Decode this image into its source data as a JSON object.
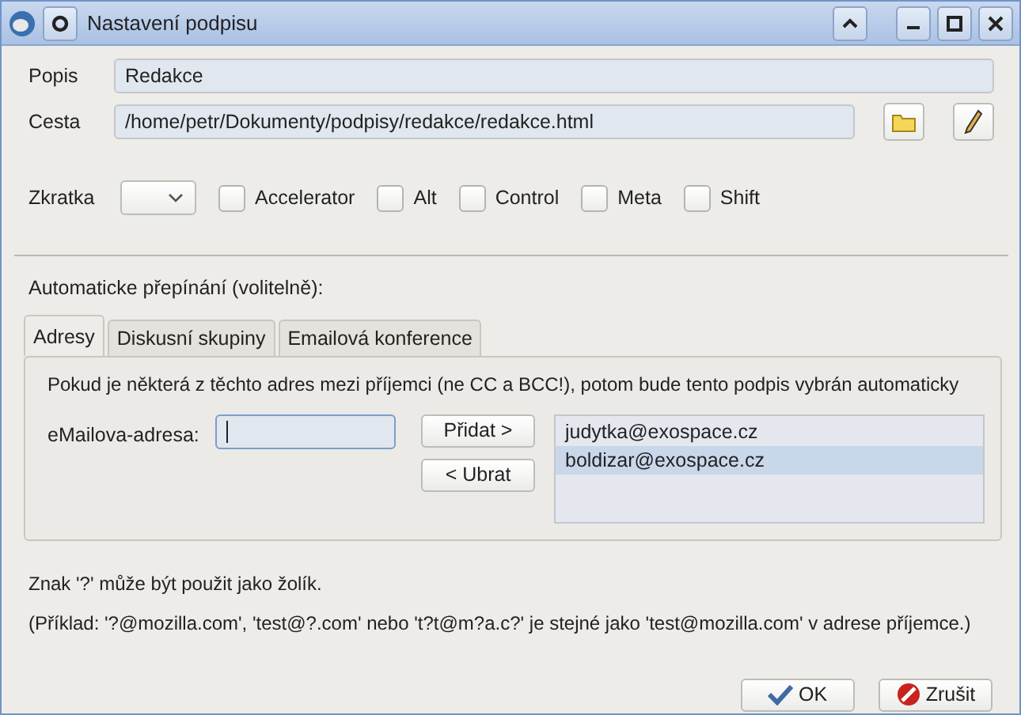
{
  "window": {
    "title": "Nastavení podpisu"
  },
  "fields": [
    {
      "label": "Popis",
      "value": "Redakce",
      "kind": "text"
    },
    {
      "label": "Cesta",
      "value": "/home/petr/Dokumenty/podpisy/redakce/redakce.html",
      "kind": "file"
    }
  ],
  "shortcut": {
    "label": "Zkratka",
    "modifiers": [
      {
        "label": "Accelerator",
        "checked": false
      },
      {
        "label": "Alt",
        "checked": false
      },
      {
        "label": "Control",
        "checked": false
      },
      {
        "label": "Meta",
        "checked": false
      },
      {
        "label": "Shift",
        "checked": false
      }
    ]
  },
  "auto_switch": {
    "label": "Automaticke přepínání (volitelně):",
    "tabs": [
      {
        "label": "Adresy",
        "selected": true
      },
      {
        "label": "Diskusní skupiny",
        "selected": false
      },
      {
        "label": "Emailová konference",
        "selected": false
      }
    ],
    "description": "Pokud je některá z těchto adres mezi příjemci (ne CC a BCC!), potom bude tento podpis vybrán automaticky",
    "address_label": "eMailova-adresa:",
    "add_button": "Přidat >",
    "remove_button": "< Ubrat",
    "addresses": [
      {
        "text": "judytka@exospace.cz",
        "selected": false
      },
      {
        "text": "boldizar@exospace.cz",
        "selected": true
      }
    ]
  },
  "hints": [
    "Znak '?' může být použit jako žolík.",
    "(Příklad: '?@mozilla.com', 'test@?.com' nebo 't?t@m?a.c?' je stejné jako 'test@mozilla.com' v adrese příjemce.)"
  ],
  "buttons": [
    {
      "label": "OK",
      "kind": "ok"
    },
    {
      "label": "Zrušit",
      "kind": "cancel"
    }
  ]
}
